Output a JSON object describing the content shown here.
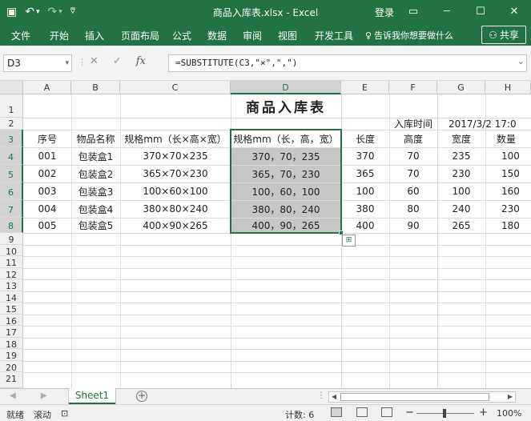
{
  "window": {
    "title": "商品入库表.xlsx  -  Excel",
    "login": "登录",
    "controls": {
      "restore": "▭",
      "minimize": "─",
      "maximize": "☐",
      "close": "✕"
    }
  },
  "qat": {
    "save_icon": "▣",
    "undo_icon": "↶",
    "undo_dd": "▾",
    "redo_icon": "↷",
    "redo_dd": "▾",
    "customize_icon": "⩢"
  },
  "ribbon": {
    "tabs": [
      "文件",
      "开始",
      "插入",
      "页面布局",
      "公式",
      "数据",
      "审阅",
      "视图",
      "开发工具"
    ],
    "tell_icon": "♀",
    "tell_me": "告诉我你想要做什么",
    "share_icon": "⚇",
    "share": "共享"
  },
  "formula_bar": {
    "name_box": "D3",
    "dropdown_icon": "▾",
    "menu_icon": "⋮",
    "cancel_icon": "✕",
    "enter_icon": "✓",
    "fx_icon": "fx",
    "formula": "=SUBSTITUTE(C3,\"×\",\",\")",
    "expand_icon": "⌄"
  },
  "sheet": {
    "columns": [
      "A",
      "B",
      "C",
      "D",
      "E",
      "F",
      "G",
      "H"
    ],
    "rows": [
      "1",
      "2",
      "3",
      "4",
      "5",
      "6",
      "7",
      "8",
      "9",
      "10",
      "11",
      "12",
      "13",
      "14",
      "15",
      "16",
      "17",
      "18",
      "19",
      "20",
      "21"
    ],
    "title": "商品入库表",
    "date_label": "入库时间",
    "date_value": "2017/3/2 17:0",
    "headers": [
      "序号",
      "物品名称",
      "规格mm（长×高×宽）",
      "规格mm（长，高，宽）",
      "长度",
      "高度",
      "宽度",
      "数量"
    ],
    "data": [
      [
        "001",
        "包装盒1",
        "370×70×235",
        "370，70，235",
        "370",
        "70",
        "235",
        "100"
      ],
      [
        "002",
        "包装盒2",
        "365×70×230",
        "365，70，230",
        "365",
        "70",
        "230",
        "150"
      ],
      [
        "003",
        "包装盒3",
        "100×60×100",
        "100，60，100",
        "100",
        "60",
        "100",
        "160"
      ],
      [
        "004",
        "包装盒4",
        "380×80×240",
        "380，80，240",
        "380",
        "80",
        "240",
        "230"
      ],
      [
        "005",
        "包装盒5",
        "400×90×265",
        "400，90，265",
        "400",
        "90",
        "265",
        "180"
      ]
    ],
    "quick_analysis_icon": "⊞"
  },
  "tabs_bar": {
    "sheet_name": "Sheet1",
    "add_icon": "+",
    "nav_prev_icon": "◀",
    "nav_next_icon": "▶",
    "dots": "⋮",
    "scroll_left": "◀",
    "scroll_right": "▶"
  },
  "status": {
    "mode": "就绪",
    "scroll": "滚动",
    "macro_icon": "⊡",
    "count": "计数: 6",
    "zoom_minus": "−",
    "zoom_plus": "+",
    "zoom": "100%"
  },
  "colors": {
    "accent": "#217346",
    "selection_fill": "#c6c6c6"
  }
}
